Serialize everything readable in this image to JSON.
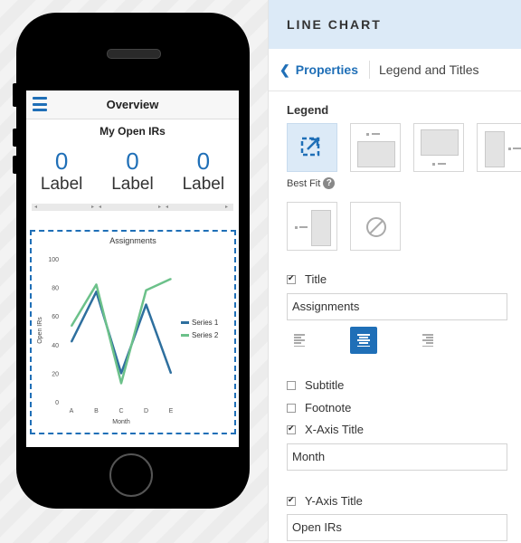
{
  "app": {
    "header_title": "Overview",
    "section_title": "My Open IRs",
    "metrics": [
      {
        "value": "0",
        "label": "Label"
      },
      {
        "value": "0",
        "label": "Label"
      },
      {
        "value": "0",
        "label": "Label"
      }
    ]
  },
  "chart_data": {
    "type": "line",
    "title": "Assignments",
    "xlabel": "Month",
    "ylabel": "Open IRs",
    "categories": [
      "A",
      "B",
      "C",
      "D",
      "E"
    ],
    "ylim": [
      0,
      100
    ],
    "yticks": [
      0,
      20,
      40,
      60,
      80,
      100
    ],
    "series": [
      {
        "name": "Series 1",
        "color": "#2e6f9e",
        "values": [
          42,
          77,
          20,
          68,
          20
        ]
      },
      {
        "name": "Series 2",
        "color": "#6cc18a",
        "values": [
          53,
          82,
          13,
          78,
          86
        ]
      }
    ],
    "legend_position": "right",
    "grid": false
  },
  "panel": {
    "header": "LINE CHART",
    "breadcrumb_back": "Properties",
    "breadcrumb_current": "Legend and Titles",
    "legend_section": "Legend",
    "best_fit_label": "Best Fit",
    "help_glyph": "?",
    "title_label": "Title",
    "title_checked": true,
    "title_value": "Assignments",
    "subtitle_label": "Subtitle",
    "subtitle_checked": false,
    "footnote_label": "Footnote",
    "footnote_checked": false,
    "xaxis_label": "X-Axis Title",
    "xaxis_checked": true,
    "xaxis_value": "Month",
    "yaxis_label": "Y-Axis Title",
    "yaxis_checked": true,
    "yaxis_value": "Open IRs",
    "alignment_selected": "center",
    "colors": {
      "accent": "#1f6fb7",
      "header_bg": "#dceaf7"
    }
  }
}
